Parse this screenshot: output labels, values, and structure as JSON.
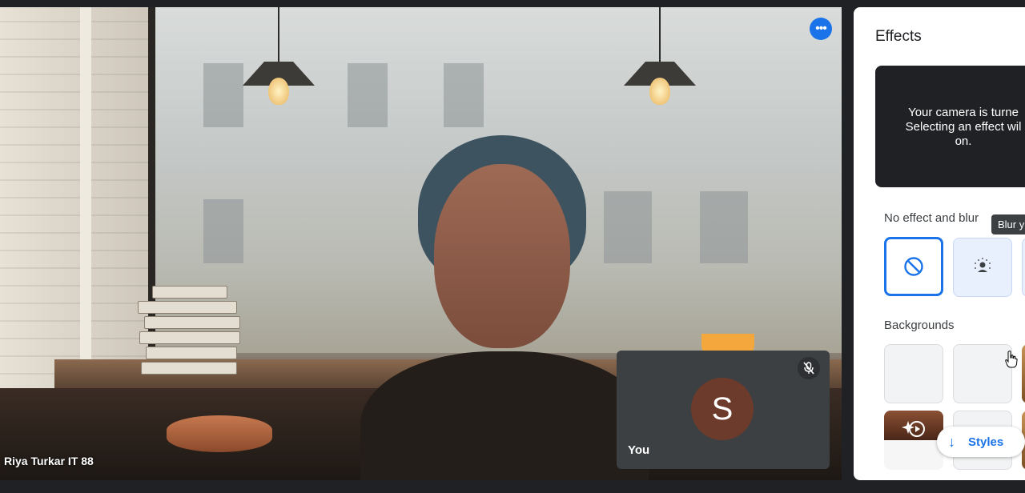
{
  "video": {
    "participant_name": "Riya Turkar IT 88",
    "more_options_icon": "more-horiz-icon"
  },
  "self_tile": {
    "avatar_letter": "S",
    "label": "You",
    "mic_icon": "mic-off-icon"
  },
  "effects_panel": {
    "title": "Effects",
    "camera_message": "Your camera is turne\nSelecting an effect wil\non.",
    "section_no_effect": "No effect and blur",
    "tooltip": "Blur y",
    "section_backgrounds": "Backgrounds",
    "styles_button": "Styles"
  },
  "colors": {
    "accent": "#1a73e8",
    "avatar_bg": "#6d3b2c",
    "panel_bg": "#ffffff",
    "page_bg": "#202124"
  }
}
